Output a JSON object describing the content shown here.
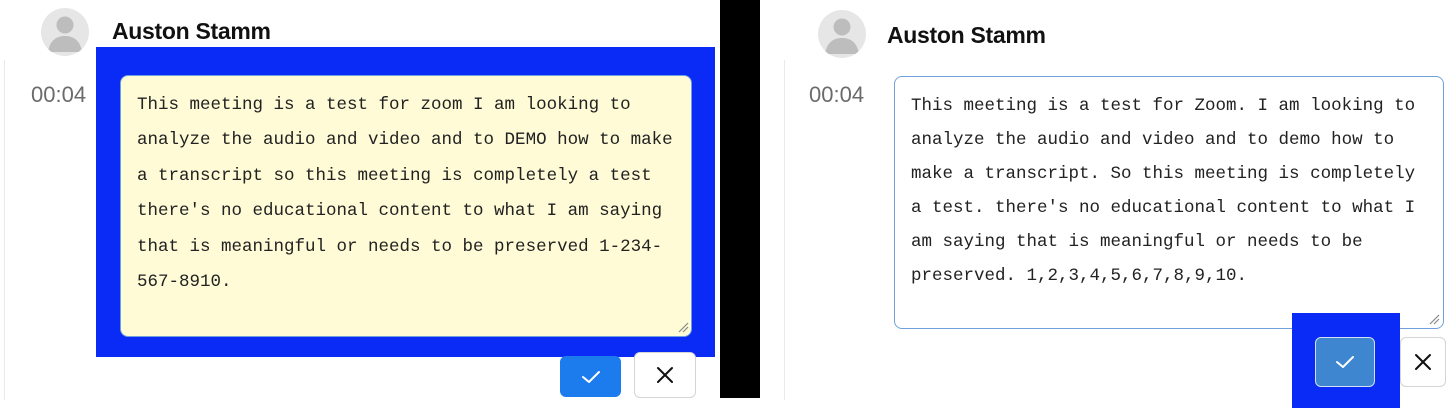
{
  "comparison": {
    "left": {
      "user_name": "Auston Stamm",
      "timestamp": "00:04",
      "transcript_text": "This meeting is a test for zoom I am looking to analyze the audio and video and to DEMO how to make a transcript so this meeting is completely a test there's no educational content to what I am saying that is meaningful or needs to be preserved 1-234-567-8910.",
      "confirm_icon": "checkmark-icon",
      "cancel_icon": "close-icon"
    },
    "right": {
      "user_name": "Auston Stamm",
      "timestamp": "00:04",
      "transcript_text": "This meeting is a test for Zoom. I am looking to analyze the audio and video and to demo how to make a transcript. So this meeting is completely a test. there's no educational content to what I am saying that is meaningful or needs to be preserved. 1,2,3,4,5,6,7,8,9,10.",
      "confirm_icon": "checkmark-icon",
      "cancel_icon": "close-icon"
    }
  },
  "colors": {
    "highlight": "#0a2bf5",
    "divider": "#000000",
    "editor_left_bg": "#fefbd6",
    "editor_border": "#6fa0dc",
    "confirm_button": "#1c7ced",
    "confirm_button_right": "#3e86cf",
    "timestamp_text": "#6b6b6b",
    "name_text": "#111111"
  },
  "icons": {
    "avatar": "default-user-avatar-icon",
    "confirm": "checkmark-icon",
    "cancel": "close-icon",
    "resize": "resize-grip-icon"
  }
}
